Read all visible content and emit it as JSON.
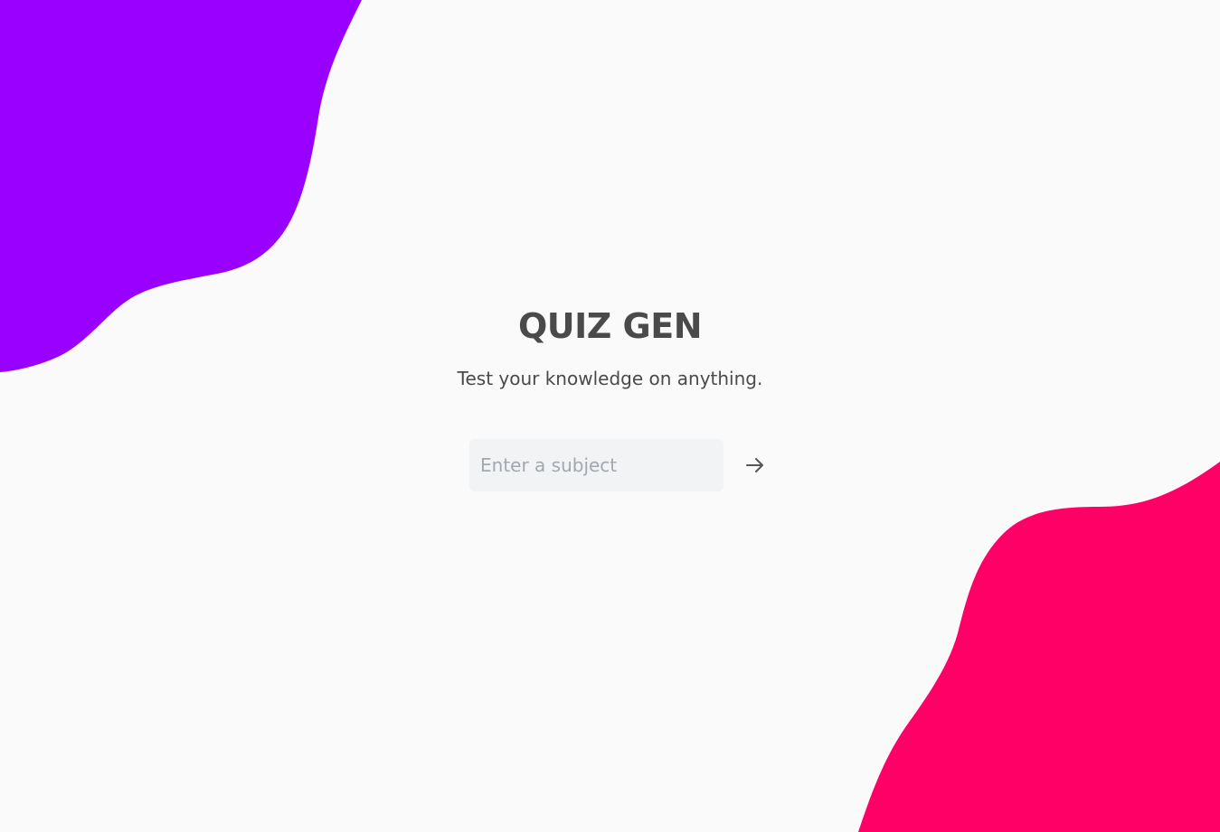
{
  "app": {
    "title": "QUIZ GEN",
    "subtitle": "Test your knowledge on anything."
  },
  "form": {
    "subject_placeholder": "Enter a subject",
    "subject_value": "",
    "submit_icon": "arrow-right-icon"
  },
  "colors": {
    "background": "#fafafa",
    "blob_top_left": "#9900ff",
    "blob_bottom_right": "#ff0066",
    "text": "#4a4a4a",
    "input_background": "#f1f3f5",
    "placeholder": "#a3a8b0",
    "icon": "#555555"
  }
}
